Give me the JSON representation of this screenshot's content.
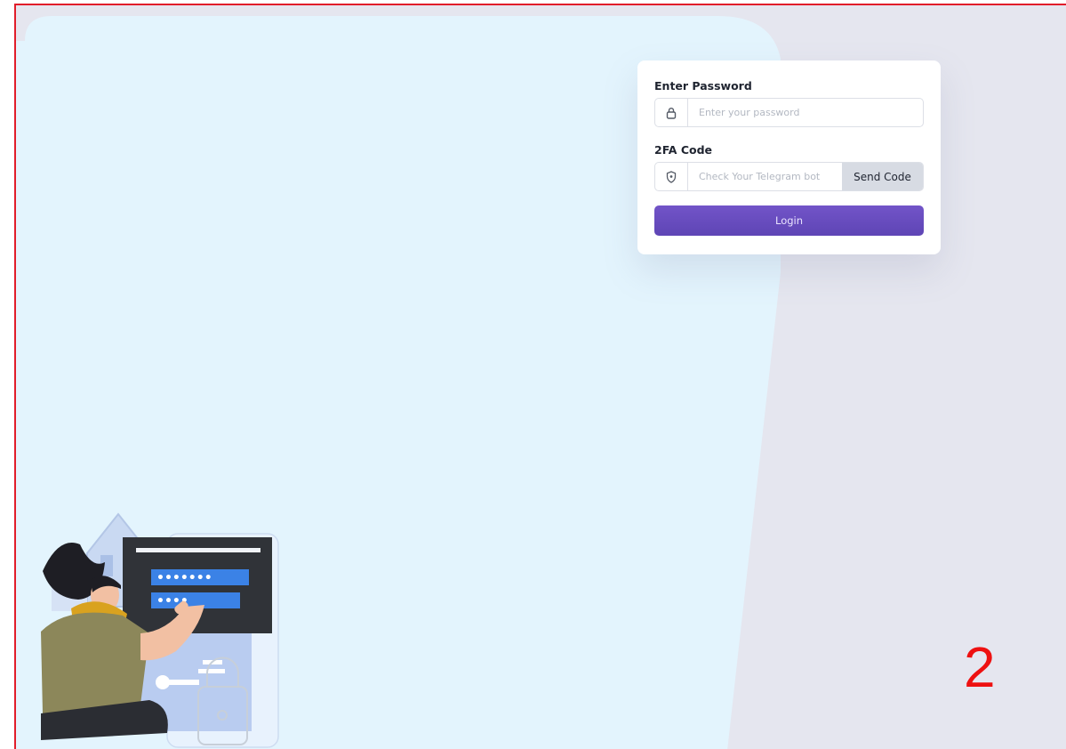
{
  "login_form": {
    "password": {
      "label": "Enter Password",
      "placeholder": "Enter your password",
      "value": "",
      "icon": "lock-icon"
    },
    "twofa": {
      "label": "2FA Code",
      "placeholder": "Check Your Telegram bot",
      "value": "",
      "icon": "shield-icon",
      "send_code_label": "Send Code"
    },
    "login_label": "Login"
  },
  "slide_number": "2",
  "colors": {
    "page_background": "#e5e6ef",
    "panel_background": "#e3f4fd",
    "card_background": "#ffffff",
    "login_button": "#6a4fc2",
    "send_code_button": "#d7dbe3",
    "frame_border": "#e11d2a",
    "slide_number": "#ee1111"
  },
  "illustration": {
    "subject": "person-entering-password-illustration",
    "masked_fields": [
      "•••••••",
      "••••"
    ]
  }
}
